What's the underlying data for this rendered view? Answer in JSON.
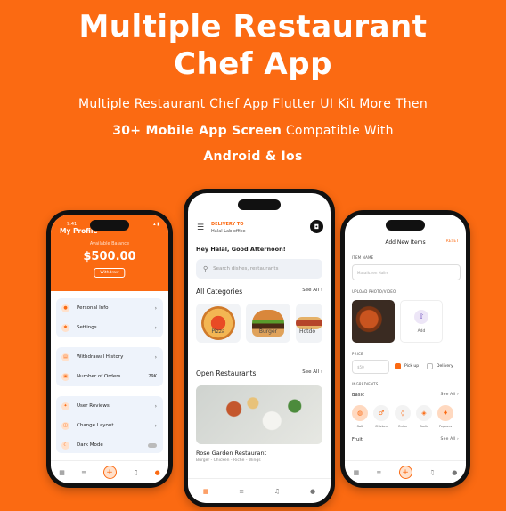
{
  "banner": {
    "title_line1": "Multiple Restaurant",
    "title_line2": "Chef App",
    "sub_line1": "Multiple Restaurant Chef App Flutter UI Kit More Then",
    "sub_line2_bold": "30+ Mobile App Screen",
    "sub_line2_rest": " Compatible With",
    "sub_line3": "Android & Ios"
  },
  "profile_screen": {
    "time": "9:41",
    "title": "My Profile",
    "balance_label": "Available Balance",
    "balance_value": "$500.00",
    "withdraw_label": "Withdraw",
    "menu_group1": [
      {
        "label": "Personal Info",
        "icon": "person-icon"
      },
      {
        "label": "Settings",
        "icon": "gear-icon"
      }
    ],
    "menu_group2": [
      {
        "label": "Withdrawal History",
        "icon": "history-icon"
      },
      {
        "label": "Number of Orders",
        "icon": "orders-icon",
        "count": "29K"
      }
    ],
    "menu_group3": [
      {
        "label": "User Reviews",
        "icon": "reviews-icon"
      },
      {
        "label": "Change Layout",
        "icon": "layout-icon"
      },
      {
        "label": "Dark Mode",
        "icon": "moon-icon"
      }
    ]
  },
  "home_screen": {
    "deliver_label": "DELIVERY TO",
    "deliver_value": "Halal Lab office",
    "greeting": "Hey Halal, Good Afternoon!",
    "search_placeholder": "Search dishes, restaurants",
    "categories_title": "All Categories",
    "see_all": "See All",
    "categories": [
      "Pizza",
      "Burger",
      "Hotdo"
    ],
    "restaurants_title": "Open Restaurants",
    "restaurant_name": "Rose Garden Restaurant",
    "restaurant_tags": "Burger - Chicken - Riche - Wings"
  },
  "add_item_screen": {
    "title": "Add New Items",
    "reset": "RESET",
    "item_name_label": "ITEM NAME",
    "item_name_value": "Mazalichen Halim",
    "upload_label": "UPLOAD PHOTO/VIDEO",
    "add_label": "Add",
    "price_label": "PRICE",
    "price_value": "$50",
    "pickup_label": "Pick up",
    "delivery_label": "Delivery",
    "ingredients_label": "INGREDIENTS",
    "basic_label": "Basic",
    "see_all": "See All",
    "ingredients": [
      "Salt",
      "Chicken",
      "Onion",
      "Garlic",
      "Peppers",
      "Gin"
    ],
    "fruit_label": "Fruit"
  },
  "colors": {
    "accent": "#fb6a12",
    "background": "#fb6a12"
  }
}
